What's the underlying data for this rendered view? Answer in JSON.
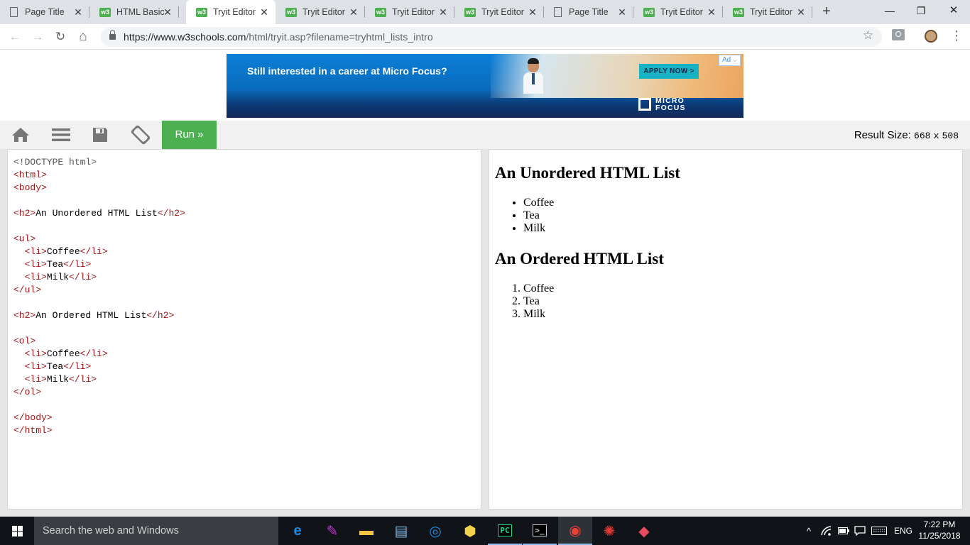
{
  "browser": {
    "tabs": [
      {
        "title": "Page Title",
        "favicon": "page-icon",
        "active": false
      },
      {
        "title": "HTML Basic",
        "favicon": "w3schools-icon",
        "active": false
      },
      {
        "title": "Tryit Editor",
        "favicon": "w3schools-icon",
        "active": true
      },
      {
        "title": "Tryit Editor",
        "favicon": "w3schools-icon",
        "active": false
      },
      {
        "title": "Tryit Editor",
        "favicon": "w3schools-icon",
        "active": false
      },
      {
        "title": "Tryit Editor",
        "favicon": "w3schools-icon",
        "active": false
      },
      {
        "title": "Page Title",
        "favicon": "page-icon",
        "active": false
      },
      {
        "title": "Tryit Editor",
        "favicon": "w3schools-icon",
        "active": false
      },
      {
        "title": "Tryit Editor",
        "favicon": "w3schools-icon",
        "active": false
      }
    ],
    "favicon_text": "w3",
    "tab_close_glyph": "✕",
    "new_tab_glyph": "+",
    "window_controls": {
      "minimize": "—",
      "restore": "❐",
      "close": "✕"
    },
    "nav": {
      "back": "←",
      "forward": "→",
      "reload": "↻",
      "home": "⌂"
    },
    "url_host": "https://www.w3schools.com",
    "url_path": "/html/tryit.asp?filename=tryhtml_lists_intro",
    "bookmark_glyph": "☆",
    "menu_glyph": "⋮"
  },
  "ad": {
    "headline": "Still interested in a career at Micro Focus?",
    "cta": "APPLY NOW >",
    "logo_line1": "MICRO",
    "logo_line2": "FOCUS",
    "logo_mark": "®",
    "badge": "Ad"
  },
  "tryit": {
    "run_label": "Run »",
    "result_size_label": "Result Size:",
    "result_width": "668",
    "result_times": "x",
    "result_height": "508"
  },
  "code_lines": [
    [
      {
        "c": "doctype",
        "t": "<!DOCTYPE html>"
      }
    ],
    [
      {
        "c": "tag",
        "t": "<html>"
      }
    ],
    [
      {
        "c": "tag",
        "t": "<body>"
      }
    ],
    [],
    [
      {
        "c": "tag",
        "t": "<h2>"
      },
      {
        "c": "txt",
        "t": "An Unordered HTML List"
      },
      {
        "c": "tag",
        "t": "</h2>"
      }
    ],
    [],
    [
      {
        "c": "tag",
        "t": "<ul>"
      }
    ],
    [
      {
        "c": "txt",
        "t": "  "
      },
      {
        "c": "tag",
        "t": "<li>"
      },
      {
        "c": "txt",
        "t": "Coffee"
      },
      {
        "c": "tag",
        "t": "</li>"
      }
    ],
    [
      {
        "c": "txt",
        "t": "  "
      },
      {
        "c": "tag",
        "t": "<li>"
      },
      {
        "c": "txt",
        "t": "Tea"
      },
      {
        "c": "tag",
        "t": "</li>"
      }
    ],
    [
      {
        "c": "txt",
        "t": "  "
      },
      {
        "c": "tag",
        "t": "<li>"
      },
      {
        "c": "txt",
        "t": "Milk"
      },
      {
        "c": "tag",
        "t": "</li>"
      }
    ],
    [
      {
        "c": "tag",
        "t": "</ul>"
      }
    ],
    [],
    [
      {
        "c": "tag",
        "t": "<h2>"
      },
      {
        "c": "txt",
        "t": "An Ordered HTML List"
      },
      {
        "c": "tag",
        "t": "</h2>"
      }
    ],
    [],
    [
      {
        "c": "tag",
        "t": "<ol>"
      }
    ],
    [
      {
        "c": "txt",
        "t": "  "
      },
      {
        "c": "tag",
        "t": "<li>"
      },
      {
        "c": "txt",
        "t": "Coffee"
      },
      {
        "c": "tag",
        "t": "</li>"
      }
    ],
    [
      {
        "c": "txt",
        "t": "  "
      },
      {
        "c": "tag",
        "t": "<li>"
      },
      {
        "c": "txt",
        "t": "Tea"
      },
      {
        "c": "tag",
        "t": "</li>"
      }
    ],
    [
      {
        "c": "txt",
        "t": "  "
      },
      {
        "c": "tag",
        "t": "<li>"
      },
      {
        "c": "txt",
        "t": "Milk"
      },
      {
        "c": "tag",
        "t": "</li>"
      }
    ],
    [
      {
        "c": "tag",
        "t": "</ol>"
      }
    ],
    [],
    [
      {
        "c": "tag",
        "t": "</body>"
      }
    ],
    [
      {
        "c": "tag",
        "t": "</html>"
      }
    ]
  ],
  "result": {
    "unordered_heading": "An Unordered HTML List",
    "unordered_items": [
      "Coffee",
      "Tea",
      "Milk"
    ],
    "ordered_heading": "An Ordered HTML List",
    "ordered_items": [
      "Coffee",
      "Tea",
      "Milk"
    ]
  },
  "taskbar": {
    "search_placeholder": "Search the web and Windows",
    "apps": [
      {
        "name": "edge-icon",
        "color": "#1e88e5",
        "glyph": "e",
        "state": ""
      },
      {
        "name": "paint-icon",
        "color": "#c934d6",
        "glyph": "✎",
        "state": ""
      },
      {
        "name": "file-explorer-icon",
        "color": "#f4c542",
        "glyph": "▬",
        "state": ""
      },
      {
        "name": "notepad-icon",
        "color": "#7fb9e8",
        "glyph": "▤",
        "state": ""
      },
      {
        "name": "outlook-icon",
        "color": "#1a8fe3",
        "glyph": "◎",
        "state": ""
      },
      {
        "name": "python-icon",
        "color": "#f2d24b",
        "glyph": "⬢",
        "state": ""
      },
      {
        "name": "pycharm-icon",
        "color": "#21d789",
        "glyph": "PC",
        "state": "open"
      },
      {
        "name": "terminal-icon",
        "color": "#cccccc",
        "glyph": ">_",
        "state": "open"
      },
      {
        "name": "chrome-icon",
        "color": "#e94235",
        "glyph": "◉",
        "state": "active"
      },
      {
        "name": "spider-icon",
        "color": "#e53935",
        "glyph": "✺",
        "state": ""
      },
      {
        "name": "eraser-app-icon",
        "color": "#e84a5f",
        "glyph": "◆",
        "state": ""
      }
    ],
    "tray": {
      "chevron": "^",
      "language": "ENG"
    },
    "time": "7:22 PM",
    "date": "11/25/2018"
  }
}
